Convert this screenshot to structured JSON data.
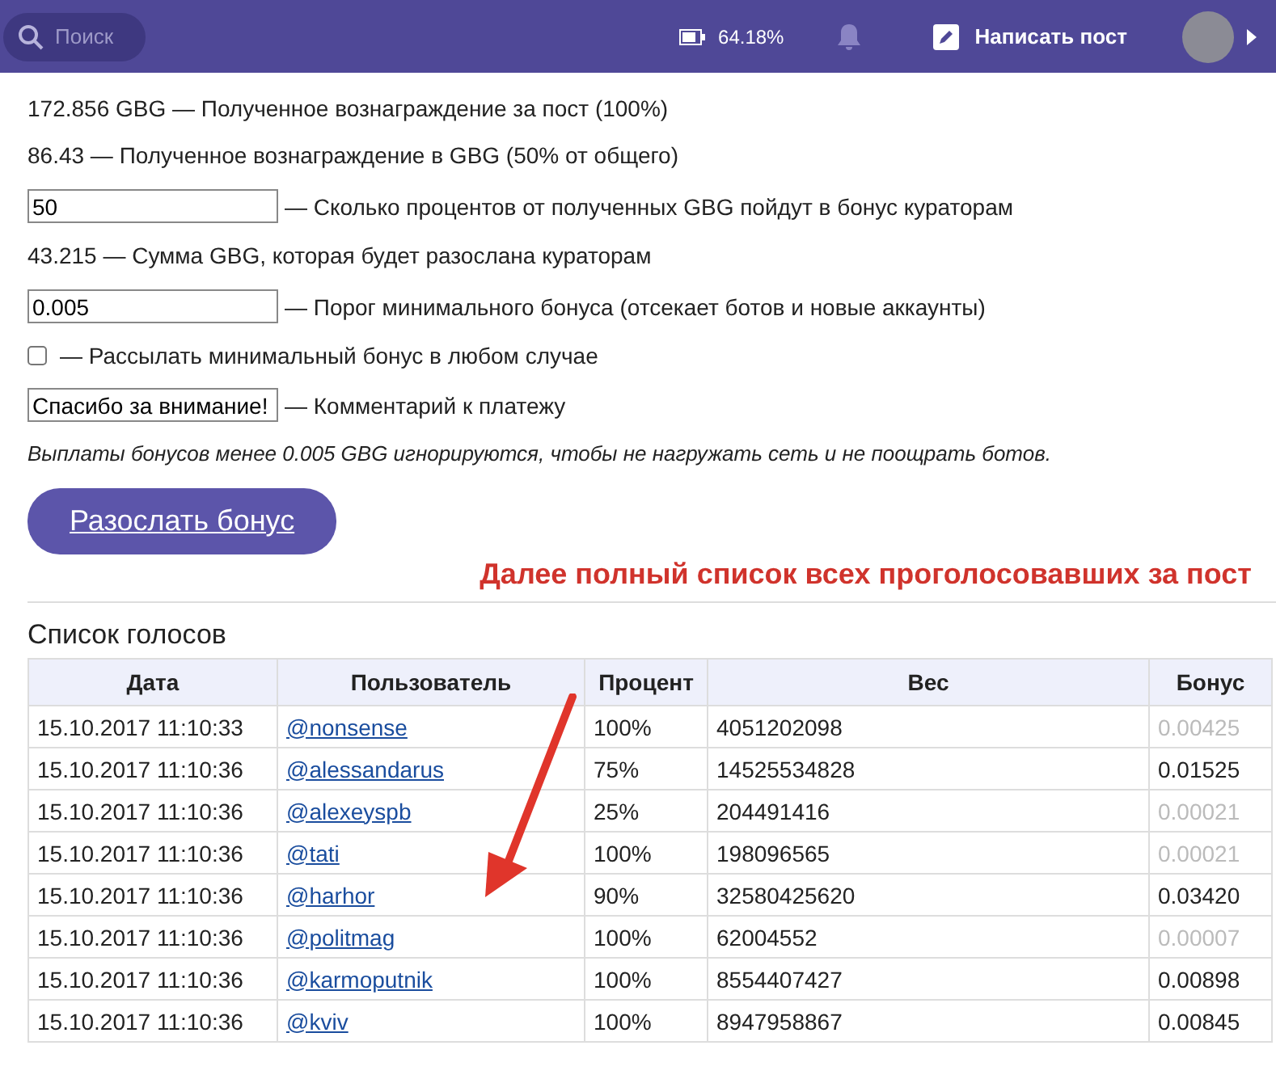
{
  "header": {
    "search": {
      "placeholder": "Поиск"
    },
    "battery": "64.18%",
    "write_post": "Написать пост"
  },
  "lines": [
    {
      "kind": "text",
      "text": "172.856 GBG — Полученное вознаграждение за пост (100%)"
    },
    {
      "kind": "text",
      "text": "86.43 — Полученное вознаграждение в GBG (50% от общего)"
    },
    {
      "kind": "input",
      "value": "50",
      "text": "— Сколько процентов от полученных GBG пойдут в бонус кураторам"
    },
    {
      "kind": "text",
      "text": "43.215 — Сумма GBG, которая будет разослана кураторам"
    },
    {
      "kind": "input",
      "value": "0.005",
      "text": "— Порог минимального бонуса (отсекает ботов и новые аккаунты)"
    },
    {
      "kind": "checkbox",
      "checked": false,
      "text": "— Рассылать минимальный бонус в любом случае"
    },
    {
      "kind": "input",
      "value": "Спасибо за внимание!",
      "text": "— Комментарий к платежу"
    },
    {
      "kind": "note",
      "text": "Выплаты бонусов менее 0.005 GBG игнорируются, чтобы не нагружать сеть и не поощрать ботов."
    }
  ],
  "send_button": "Разослать бонус",
  "annotation": "Далее полный список всех проголосовавших за пост",
  "votes": {
    "title": "Список голосов",
    "columns": [
      "Дата",
      "Пользователь",
      "Процент",
      "Вес",
      "Бонус"
    ],
    "rows": [
      {
        "date": "15.10.2017 11:10:33",
        "user": "@nonsense",
        "percent": "100%",
        "weight": "4051202098",
        "bonus": "0.00425",
        "ignored": true
      },
      {
        "date": "15.10.2017 11:10:36",
        "user": "@alessandarus",
        "percent": "75%",
        "weight": "14525534828",
        "bonus": "0.01525",
        "ignored": false
      },
      {
        "date": "15.10.2017 11:10:36",
        "user": "@alexeyspb",
        "percent": "25%",
        "weight": "204491416",
        "bonus": "0.00021",
        "ignored": true
      },
      {
        "date": "15.10.2017 11:10:36",
        "user": "@tati",
        "percent": "100%",
        "weight": "198096565",
        "bonus": "0.00021",
        "ignored": true
      },
      {
        "date": "15.10.2017 11:10:36",
        "user": "@harhor",
        "percent": "90%",
        "weight": "32580425620",
        "bonus": "0.03420",
        "ignored": false
      },
      {
        "date": "15.10.2017 11:10:36",
        "user": "@politmag",
        "percent": "100%",
        "weight": "62004552",
        "bonus": "0.00007",
        "ignored": true
      },
      {
        "date": "15.10.2017 11:10:36",
        "user": "@karmoputnik",
        "percent": "100%",
        "weight": "8554407427",
        "bonus": "0.00898",
        "ignored": false
      },
      {
        "date": "15.10.2017 11:10:36",
        "user": "@kviv",
        "percent": "100%",
        "weight": "8947958867",
        "bonus": "0.00845",
        "ignored": false
      }
    ]
  }
}
